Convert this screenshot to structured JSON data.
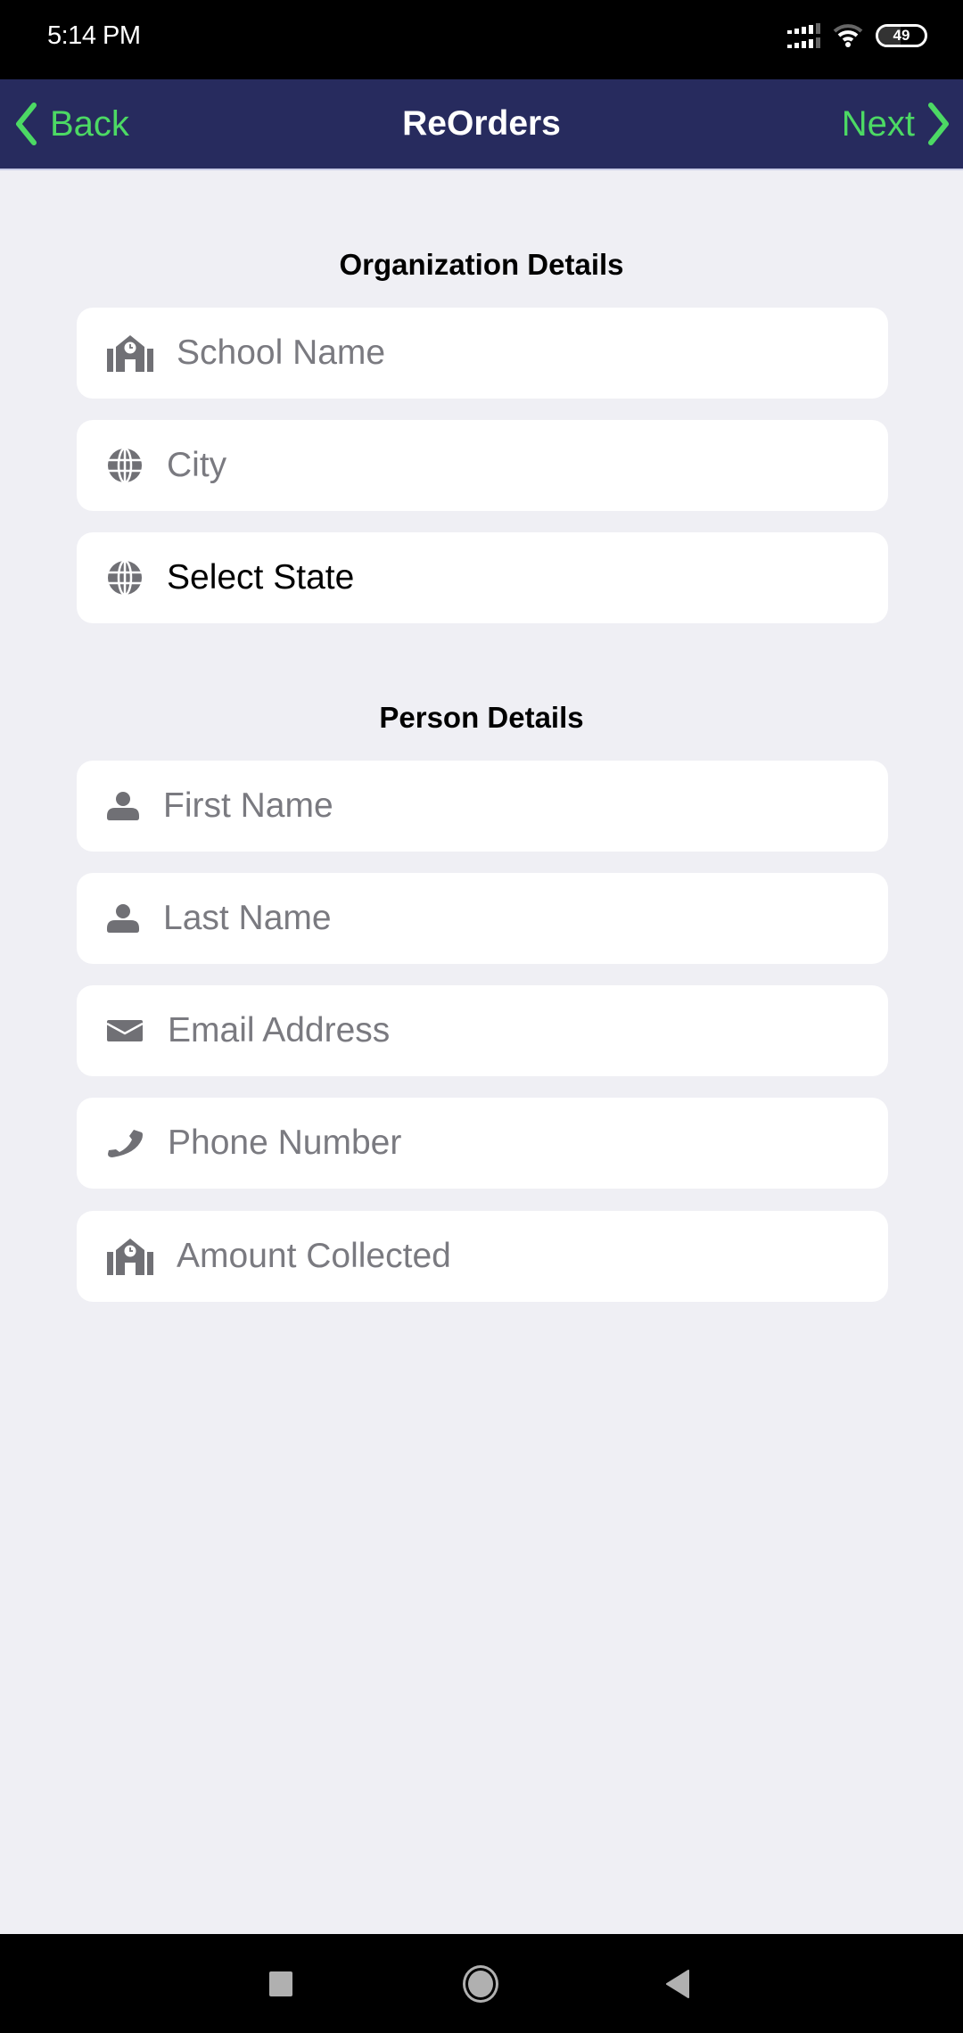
{
  "status_bar": {
    "time": "5:14 PM",
    "battery_level": "49",
    "battery_fraction": 0.49,
    "icons": [
      "signal-icon",
      "wifi-icon",
      "battery-icon"
    ]
  },
  "nav": {
    "back_label": "Back",
    "title": "ReOrders",
    "next_label": "Next",
    "accent_color": "#4cd964",
    "bar_color": "#272b5e"
  },
  "organization": {
    "title": "Organization Details",
    "school_name": {
      "placeholder": "School Name",
      "value": "",
      "icon": "school-icon"
    },
    "city": {
      "placeholder": "City",
      "value": "",
      "icon": "globe-icon"
    },
    "state": {
      "value": "Select State",
      "icon": "globe-icon"
    }
  },
  "person": {
    "title": "Person Details",
    "first_name": {
      "placeholder": "First Name",
      "value": "",
      "icon": "user-icon"
    },
    "last_name": {
      "placeholder": "Last Name",
      "value": "",
      "icon": "user-icon"
    },
    "email": {
      "placeholder": "Email Address",
      "value": "",
      "icon": "envelope-icon"
    },
    "phone": {
      "placeholder": "Phone Number",
      "value": "",
      "icon": "phone-icon"
    },
    "amount": {
      "placeholder": "Amount Collected",
      "value": "",
      "icon": "school-icon"
    }
  },
  "system_nav": {
    "buttons": [
      "recents-button",
      "home-button",
      "back-button"
    ]
  }
}
